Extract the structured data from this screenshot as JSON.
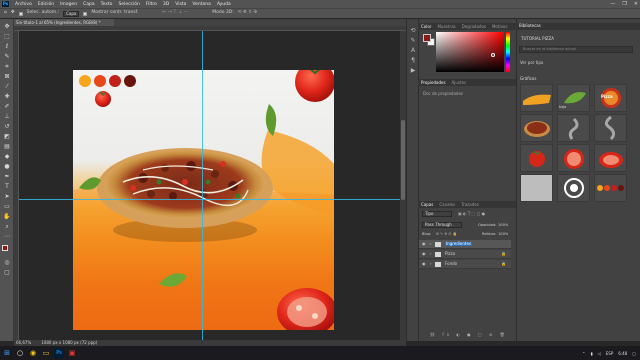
{
  "app": {
    "logo": "Ps",
    "menu": [
      "Archivo",
      "Edición",
      "Imagen",
      "Capa",
      "Texto",
      "Selección",
      "Filtro",
      "3D",
      "Vista",
      "Ventana",
      "Ayuda"
    ],
    "window_controls": [
      "—",
      "❐",
      "✕"
    ]
  },
  "options_bar": {
    "mode": "Capa",
    "auto_label": "Selec. autom.:",
    "transform_label": "Mostrar contr. transf.",
    "mode3d_label": "Modo 3D:"
  },
  "document": {
    "tab_title": "Sin título-1 al 65% (Ingredientes, RGB/8) *",
    "zoom": "66,67%",
    "size": "1080 px x 1080 px (72 ppp)"
  },
  "artboard": {
    "swatch_colors": [
      "#f7a51b",
      "#e8471a",
      "#c2201a",
      "#6a140e"
    ],
    "accent_colors": {
      "top": "#f3f3f1",
      "mid": "#f7b23d",
      "bottom": "#ec5a0e"
    }
  },
  "color_panel": {
    "tabs": [
      "Color",
      "Muestras",
      "Degradados",
      "Motivos"
    ],
    "foreground": "#8b1a14",
    "background": "#f4f4f4"
  },
  "properties_panel": {
    "tabs": [
      "Propiedades",
      "Ajustes"
    ],
    "content": "Doc de propiedades"
  },
  "layers_panel": {
    "tabs": [
      "Capas",
      "Canales",
      "Trazados"
    ],
    "filter": "Tipo",
    "blend_mode": "Pass Through",
    "opacity_label": "Opacidad:",
    "opacity_value": "100%",
    "lock_label": "Bloq:",
    "fill_label": "Relleno:",
    "fill_value": "100%",
    "layers": [
      {
        "name": "Ingredientes",
        "selected": true
      },
      {
        "name": "Pizza",
        "selected": false
      },
      {
        "name": "Fondo",
        "selected": false
      }
    ]
  },
  "libraries_panel": {
    "title": "Bibliotecas",
    "library_name": "TUTORIAL PIZZA",
    "search_placeholder": "Buscar en la biblioteca actual",
    "view_by": "Ver por tipo",
    "section": "Gráficos",
    "hoja_label": "hoja",
    "pizza_badge": "Pizza"
  },
  "taskbar": {
    "icons": [
      "windows-icon",
      "search-icon",
      "chrome-icon",
      "explorer-icon",
      "photoshop-icon",
      "media-icon"
    ],
    "lang": "ESP",
    "time": "6:48"
  },
  "status_bar": {
    "zoom": "66,67%",
    "info": "1080 px x 1080 px (72 ppp)"
  }
}
